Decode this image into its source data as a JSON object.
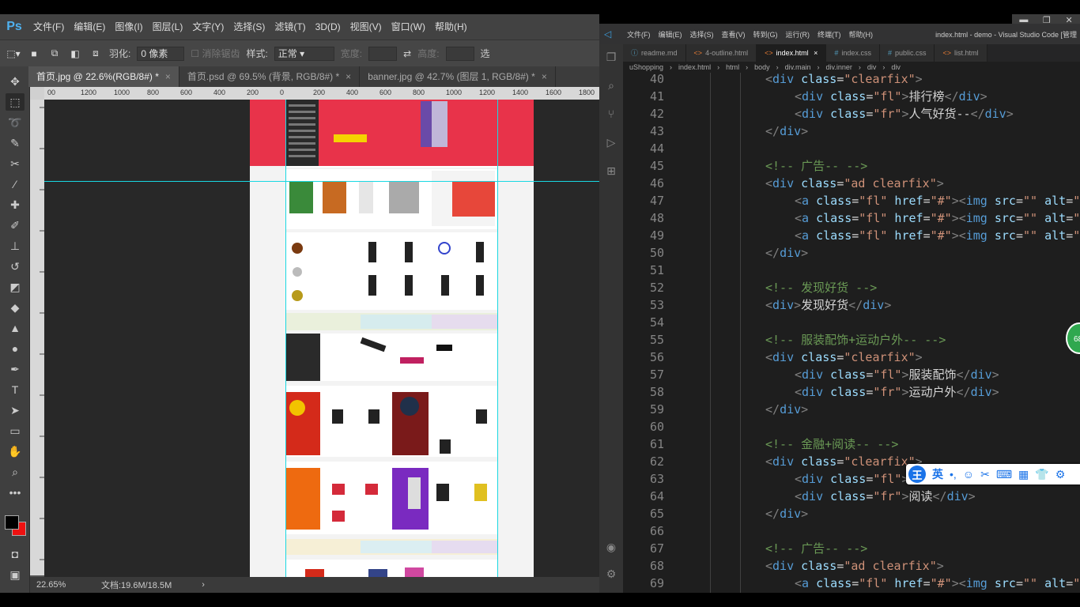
{
  "photoshop": {
    "logo": "Ps",
    "menu": [
      "文件(F)",
      "编辑(E)",
      "图像(I)",
      "图层(L)",
      "文字(Y)",
      "选择(S)",
      "滤镜(T)",
      "3D(D)",
      "视图(V)",
      "窗口(W)",
      "帮助(H)"
    ],
    "options": {
      "feather_label": "羽化:",
      "feather_value": "0 像素",
      "antialias_label": "消除锯齿",
      "style_label": "样式:",
      "style_value": "正常",
      "width_label": "宽度:",
      "height_label": "高度:",
      "select_label": "选"
    },
    "tabs": [
      {
        "label": "首页.jpg @ 22.6%(RGB/8#) *",
        "active": true
      },
      {
        "label": "首页.psd @ 69.5% (背景, RGB/8#) *",
        "active": false
      },
      {
        "label": "banner.jpg @ 42.7% (图层 1, RGB/8#) *",
        "active": false
      }
    ],
    "ruler_labels": [
      "00",
      "1200",
      "1000",
      "800",
      "600",
      "400",
      "200",
      "0",
      "200",
      "400",
      "600",
      "800",
      "1000",
      "1200",
      "1400",
      "1600",
      "1800"
    ],
    "status": {
      "zoom": "22.65%",
      "doc": "文档:19.6M/18.5M"
    }
  },
  "vscode": {
    "menu": [
      "文件(F)",
      "编辑(E)",
      "选择(S)",
      "查看(V)",
      "转到(G)",
      "运行(R)",
      "终端(T)",
      "帮助(H)"
    ],
    "title": "index.html - demo - Visual Studio Code [管理",
    "tabs": [
      {
        "label": "readme.md",
        "icon": "info",
        "active": false
      },
      {
        "label": "4-outline.html",
        "icon": "html",
        "active": false
      },
      {
        "label": "index.html",
        "icon": "html",
        "active": true
      },
      {
        "label": "index.css",
        "icon": "css",
        "active": false
      },
      {
        "label": "public.css",
        "icon": "css",
        "active": false
      },
      {
        "label": "list.html",
        "icon": "html",
        "active": false
      }
    ],
    "breadcrumbs": [
      "uShopping",
      "index.html",
      "html",
      "body",
      "div.main",
      "div.inner",
      "div",
      "div"
    ],
    "lines": [
      {
        "n": "40",
        "indent": 0,
        "code": "<div class=\"clearfix\">"
      },
      {
        "n": "41",
        "indent": 1,
        "code": "<div class=\"fl\">排行榜</div>"
      },
      {
        "n": "42",
        "indent": 1,
        "code": "<div class=\"fr\">人气好货--</div>"
      },
      {
        "n": "43",
        "indent": 0,
        "code": "</div>"
      },
      {
        "n": "44",
        "indent": 0,
        "code": ""
      },
      {
        "n": "45",
        "indent": 0,
        "code": "<!-- 广告-- -->"
      },
      {
        "n": "46",
        "indent": 0,
        "code": "<div class=\"ad clearfix\">"
      },
      {
        "n": "47",
        "indent": 1,
        "code": "<a class=\"fl\" href=\"#\"><img src=\"\" alt=\""
      },
      {
        "n": "48",
        "indent": 1,
        "code": "<a class=\"fl\" href=\"#\"><img src=\"\" alt=\""
      },
      {
        "n": "49",
        "indent": 1,
        "code": "<a class=\"fl\" href=\"#\"><img src=\"\" alt=\""
      },
      {
        "n": "50",
        "indent": 0,
        "code": "</div>"
      },
      {
        "n": "51",
        "indent": 0,
        "code": ""
      },
      {
        "n": "52",
        "indent": 0,
        "code": "<!-- 发现好货 -->"
      },
      {
        "n": "53",
        "indent": 0,
        "code": "<div>发现好货</div>"
      },
      {
        "n": "54",
        "indent": 0,
        "code": ""
      },
      {
        "n": "55",
        "indent": 0,
        "code": "<!-- 服装配饰+运动户外-- -->"
      },
      {
        "n": "56",
        "indent": 0,
        "code": "<div class=\"clearfix\">"
      },
      {
        "n": "57",
        "indent": 1,
        "code": "<div class=\"fl\">服装配饰</div>"
      },
      {
        "n": "58",
        "indent": 1,
        "code": "<div class=\"fr\">运动户外</div>"
      },
      {
        "n": "59",
        "indent": 0,
        "code": "</div>"
      },
      {
        "n": "60",
        "indent": 0,
        "code": ""
      },
      {
        "n": "61",
        "indent": 0,
        "code": "<!-- 金融+阅读-- -->"
      },
      {
        "n": "62",
        "indent": 0,
        "code": "<div class=\"clearfix\">"
      },
      {
        "n": "63",
        "indent": 1,
        "code": "<div class=\"fl\">金融</div>"
      },
      {
        "n": "64",
        "indent": 1,
        "code": "<div class=\"fr\">阅读</div>"
      },
      {
        "n": "65",
        "indent": 0,
        "code": "</div>"
      },
      {
        "n": "66",
        "indent": 0,
        "code": ""
      },
      {
        "n": "67",
        "indent": 0,
        "code": "<!-- 广告-- -->"
      },
      {
        "n": "68",
        "indent": 0,
        "code": "<div class=\"ad clearfix\">"
      },
      {
        "n": "69",
        "indent": 1,
        "code": "<a class=\"fl\" href=\"#\"><img src=\"\" alt=\""
      }
    ]
  },
  "ime_toolbar": {
    "logo": "王",
    "lang": "英"
  },
  "badge": "68",
  "colors": {
    "ps_bg": "#535353",
    "vs_bg": "#1e1e1e",
    "guide": "#19d8e2",
    "accent_red": "#e8334a"
  }
}
